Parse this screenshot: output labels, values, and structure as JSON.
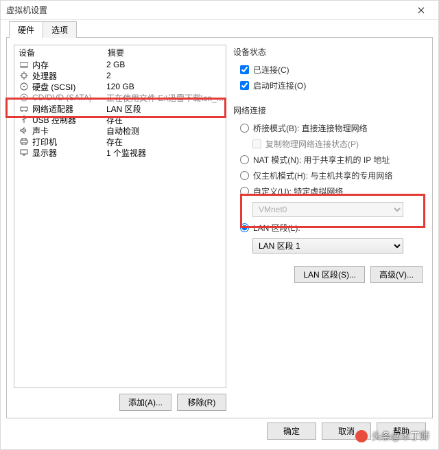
{
  "window": {
    "title": "虚拟机设置"
  },
  "tabs": {
    "hardware": "硬件",
    "options": "选项"
  },
  "devlist": {
    "col_device": "设备",
    "col_summary": "摘要",
    "rows": [
      {
        "icon": "memory-icon",
        "label": "内存",
        "summary": "2 GB"
      },
      {
        "icon": "cpu-icon",
        "label": "处理器",
        "summary": "2"
      },
      {
        "icon": "disk-icon",
        "label": "硬盘 (SCSI)",
        "summary": "120 GB"
      },
      {
        "icon": "cd-icon",
        "label": "CD/DVD (SATA)",
        "summary": "正在使用文件 E:\\迅雷下载\\cn_..."
      },
      {
        "icon": "network-icon",
        "label": "网络适配器",
        "summary": "LAN 区段"
      },
      {
        "icon": "usb-icon",
        "label": "USB 控制器",
        "summary": "存在"
      },
      {
        "icon": "sound-icon",
        "label": "声卡",
        "summary": "自动检测"
      },
      {
        "icon": "printer-icon",
        "label": "打印机",
        "summary": "存在"
      },
      {
        "icon": "display-icon",
        "label": "显示器",
        "summary": "1 个监视器"
      }
    ]
  },
  "left_buttons": {
    "add": "添加(A)...",
    "remove": "移除(R)"
  },
  "right": {
    "status": {
      "label": "设备状态",
      "connected": "已连接(C)",
      "connect_at_poweron": "启动时连接(O)"
    },
    "net": {
      "label": "网络连接",
      "bridged": "桥接模式(B): 直接连接物理网络",
      "replicate": "复制物理网络连接状态(P)",
      "nat": "NAT 模式(N): 用于共享主机的 IP 地址",
      "hostonly": "仅主机模式(H): 与主机共享的专用网络",
      "custom": "自定义(U): 特定虚拟网络",
      "custom_value": "VMnet0",
      "lanseg": "LAN 区段(L):",
      "lanseg_value": "LAN 区段 1"
    },
    "buttons": {
      "lan_segments": "LAN 区段(S)...",
      "advanced": "高级(V)..."
    }
  },
  "footer": {
    "ok": "确定",
    "cancel": "取消",
    "help": "帮助"
  },
  "watermark": "头条@木丁师"
}
